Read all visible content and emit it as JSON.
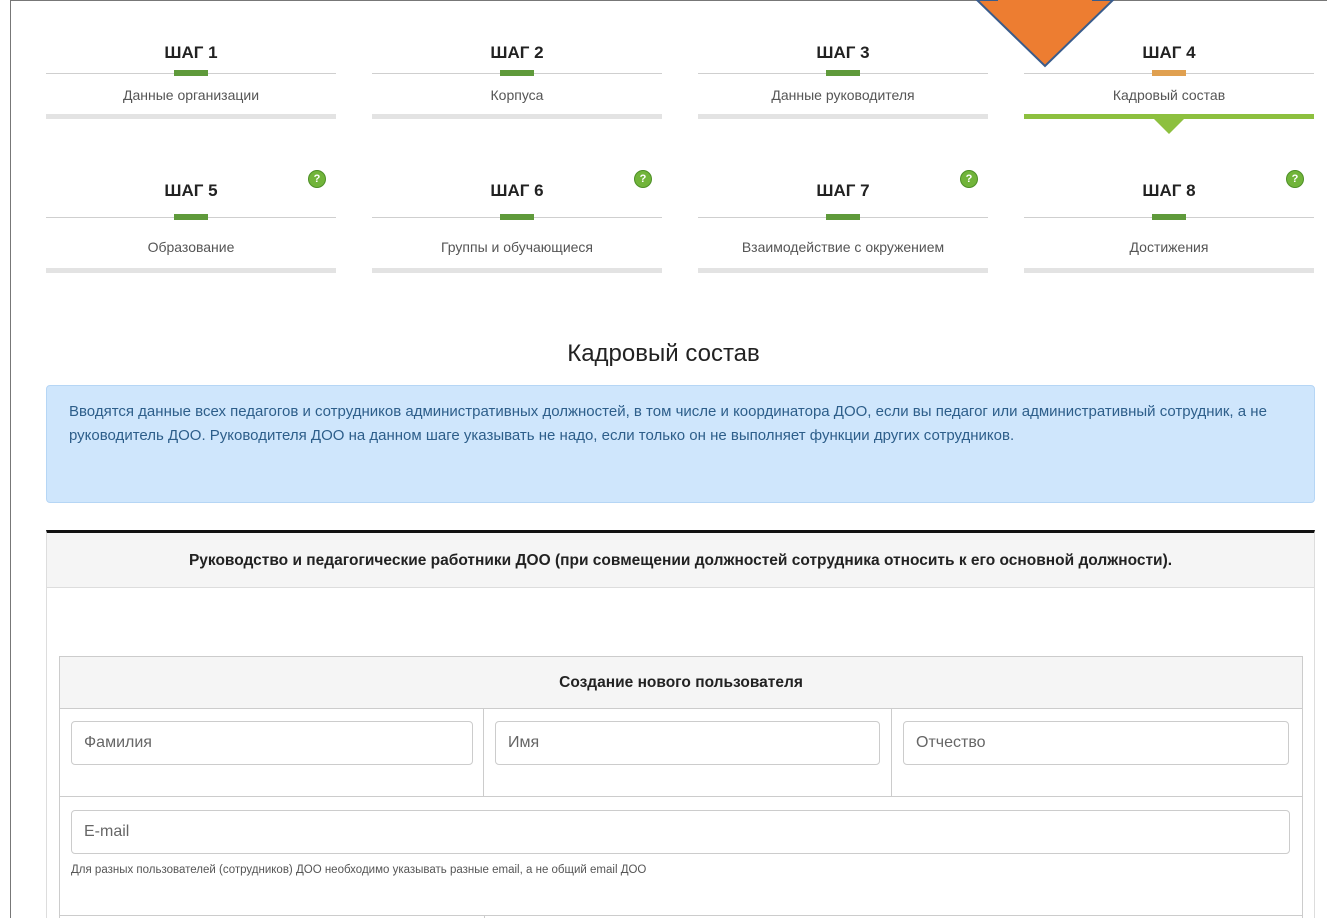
{
  "steps": [
    {
      "title": "ШАГ 1",
      "label": "Данные организации"
    },
    {
      "title": "ШАГ 2",
      "label": "Корпуса"
    },
    {
      "title": "ШАГ 3",
      "label": "Данные руководителя"
    },
    {
      "title": "ШАГ 4",
      "label": "Кадровый состав",
      "current": true
    },
    {
      "title": "ШАГ 5",
      "label": "Образование",
      "help": "?"
    },
    {
      "title": "ШАГ 6",
      "label": "Группы и обучающиеся",
      "help": "?"
    },
    {
      "title": "ШАГ 7",
      "label": "Взаимодействие с окружением",
      "help": "?"
    },
    {
      "title": "ШАГ 8",
      "label": "Достижения",
      "help": "?"
    }
  ],
  "section_title": "Кадровый состав",
  "info_text": "Вводятся данные всех педагогов и сотрудников административных должностей, в том числе и координатора ДОО, если вы педагог или административный сотрудник, а не руководитель ДОО. Руководителя ДОО на данном шаге указывать не надо, если только он не выполняет функции других сотрудников.",
  "panel_title": "Руководство и педагогические работники ДОО (при совмещении должностей сотрудника относить к его основной должности).",
  "create_user": {
    "title": "Создание нового пользователя",
    "surname_placeholder": "Фамилия",
    "name_placeholder": "Имя",
    "patronymic_placeholder": "Отчество",
    "email_placeholder": "E-mail",
    "email_hint": "Для разных пользователей (сотрудников) ДОО необходимо указывать разные email, а не общий email ДОО"
  },
  "colors": {
    "step_done": "#5f9a3b",
    "step_current": "#e0a050",
    "active_bar": "#8dc03f",
    "info_bg": "#cfe6fc",
    "annotation_arrow": "#ed7d31"
  }
}
